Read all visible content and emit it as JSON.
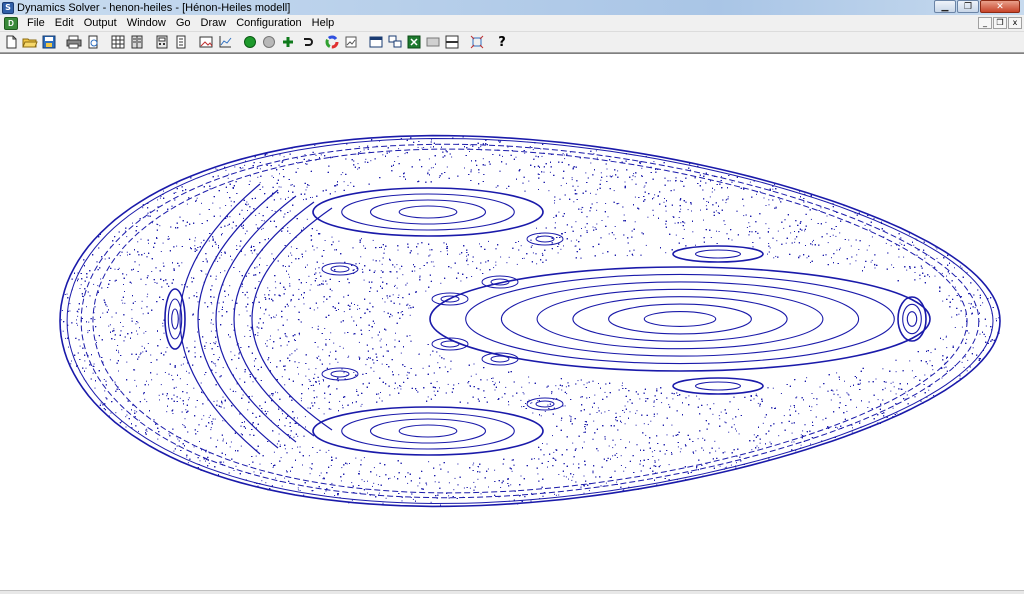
{
  "window": {
    "title": "Dynamics Solver - henon-heiles - [Hénon-Heiles modell]",
    "controls": {
      "minimize": "▁",
      "maximize": "❐",
      "close": "✕"
    }
  },
  "menubar": {
    "items": [
      "File",
      "Edit",
      "Output",
      "Window",
      "Go",
      "Draw",
      "Configuration",
      "Help"
    ],
    "mdi_controls": {
      "minimize": "_",
      "restore": "❐",
      "close": "x"
    }
  },
  "toolbar": {
    "buttons": [
      {
        "name": "new-file-icon"
      },
      {
        "name": "open-folder-icon"
      },
      {
        "name": "save-icon"
      },
      {
        "name": "print-icon"
      },
      {
        "name": "print-preview-icon"
      },
      {
        "name": "table-icon"
      },
      {
        "name": "book-icon"
      },
      {
        "name": "calculator-icon"
      },
      {
        "name": "document-icon"
      },
      {
        "name": "picture-icon"
      },
      {
        "name": "plot-axes-icon"
      },
      {
        "name": "run-green-icon"
      },
      {
        "name": "run-gray-icon"
      },
      {
        "name": "add-plus-icon"
      },
      {
        "name": "undo-icon"
      },
      {
        "name": "color-wheel-icon"
      },
      {
        "name": "graph-settings-icon"
      },
      {
        "name": "single-window-icon"
      },
      {
        "name": "tile-windows-icon"
      },
      {
        "name": "excel-icon"
      },
      {
        "name": "panel-icon"
      },
      {
        "name": "split-icon"
      },
      {
        "name": "zoom-fit-icon"
      }
    ],
    "help_label": "?"
  },
  "plot": {
    "description_type": "Poincaré section scatter",
    "point_color": "#1a1aaa"
  }
}
